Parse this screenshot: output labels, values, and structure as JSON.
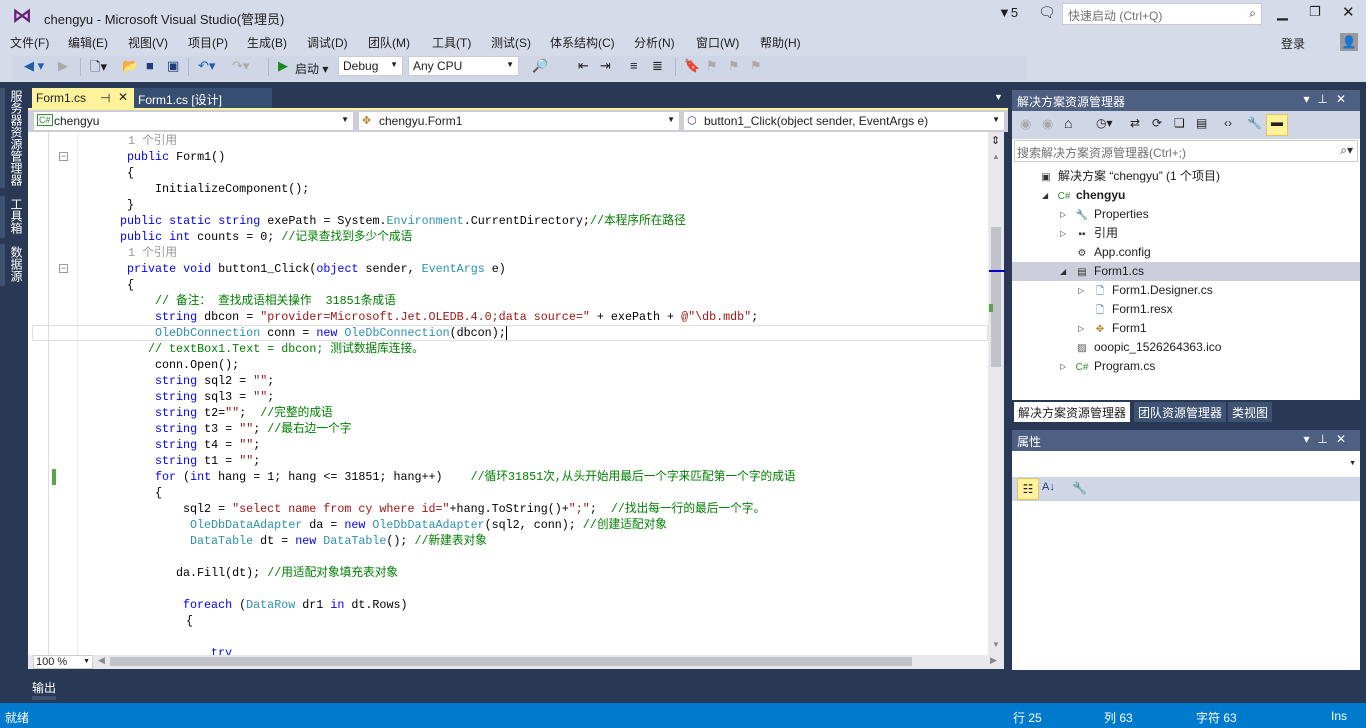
{
  "window": {
    "title": "chengyu - Microsoft Visual Studio(管理员)",
    "notifications": "5",
    "quick_launch_placeholder": "快速启动 (Ctrl+Q)",
    "sign_in": "登录"
  },
  "menu": [
    "文件(F)",
    "编辑(E)",
    "视图(V)",
    "项目(P)",
    "生成(B)",
    "调试(D)",
    "团队(M)",
    "工具(T)",
    "测试(S)",
    "体系结构(C)",
    "分析(N)",
    "窗口(W)",
    "帮助(H)"
  ],
  "toolbar": {
    "start": "启动",
    "configuration": "Debug",
    "platform": "Any CPU"
  },
  "left_tabs": [
    "服务器资源管理器",
    "工具箱",
    "数据源"
  ],
  "doc_tabs": [
    {
      "label": "Form1.cs",
      "active": true
    },
    {
      "label": "Form1.cs [设计]",
      "active": false
    }
  ],
  "navbar": {
    "project": "chengyu",
    "class": "chengyu.Form1",
    "member": "button1_Click(object sender, EventArgs e)"
  },
  "code": [
    {
      "indent": 100,
      "tokens": [
        [
          "1 个引用",
          "ln"
        ]
      ]
    },
    {
      "indent": 99,
      "fold": true,
      "tokens": [
        [
          "public",
          "kw"
        ],
        [
          " Form1()",
          "pl"
        ]
      ]
    },
    {
      "indent": 99,
      "tokens": [
        [
          "{",
          "pl"
        ]
      ]
    },
    {
      "indent": 127,
      "tokens": [
        [
          "InitializeComponent();",
          "pl"
        ]
      ]
    },
    {
      "indent": 99,
      "tokens": [
        [
          "}",
          "pl"
        ]
      ]
    },
    {
      "indent": 92,
      "tokens": [
        [
          "public static string",
          "kw"
        ],
        [
          " exePath = System.",
          "pl"
        ],
        [
          "Environment",
          "ty"
        ],
        [
          ".CurrentDirectory;",
          "pl"
        ],
        [
          "//本程序所在路径",
          "cm"
        ]
      ]
    },
    {
      "indent": 92,
      "tokens": [
        [
          "public int",
          "kw"
        ],
        [
          " counts = 0; ",
          "pl"
        ],
        [
          "//记录查找到多少个成语",
          "cm"
        ]
      ]
    },
    {
      "indent": 100,
      "tokens": [
        [
          "1 个引用",
          "ln"
        ]
      ]
    },
    {
      "indent": 99,
      "fold": true,
      "tokens": [
        [
          "private void",
          "kw"
        ],
        [
          " button1_Click(",
          "pl"
        ],
        [
          "object",
          "kw"
        ],
        [
          " sender, ",
          "pl"
        ],
        [
          "EventArgs",
          "ty"
        ],
        [
          " e)",
          "pl"
        ]
      ]
    },
    {
      "indent": 99,
      "tokens": [
        [
          "{",
          "pl"
        ]
      ]
    },
    {
      "indent": 127,
      "tokens": [
        [
          "// 备注： 查找成语相关操作  31851条成语",
          "cm"
        ]
      ]
    },
    {
      "indent": 127,
      "tokens": [
        [
          "string",
          "kw"
        ],
        [
          " dbcon = ",
          "pl"
        ],
        [
          "\"provider=Microsoft.Jet.OLEDB.4.0;data source=\"",
          "st"
        ],
        [
          " + exePath + ",
          "pl"
        ],
        [
          "@\"\\db.mdb\"",
          "st"
        ],
        [
          ";",
          "pl"
        ]
      ]
    },
    {
      "indent": 127,
      "current": true,
      "tokens": [
        [
          "OleDbConnection",
          "ty"
        ],
        [
          " conn = ",
          "pl"
        ],
        [
          "new",
          "kw"
        ],
        [
          " ",
          "pl"
        ],
        [
          "OleDbConnection",
          "ty"
        ],
        [
          "(dbcon);",
          "pl"
        ]
      ]
    },
    {
      "indent": 120,
      "tokens": [
        [
          "// textBox1.Text = dbcon; 测试数据库连接。",
          "cm"
        ]
      ]
    },
    {
      "indent": 127,
      "tokens": [
        [
          "conn.Open();",
          "pl"
        ]
      ]
    },
    {
      "indent": 127,
      "tokens": [
        [
          "string",
          "kw"
        ],
        [
          " sql2 = ",
          "pl"
        ],
        [
          "\"\"",
          "st"
        ],
        [
          ";",
          "pl"
        ]
      ]
    },
    {
      "indent": 127,
      "tokens": [
        [
          "string",
          "kw"
        ],
        [
          " sql3 = ",
          "pl"
        ],
        [
          "\"\"",
          "st"
        ],
        [
          ";",
          "pl"
        ]
      ]
    },
    {
      "indent": 127,
      "tokens": [
        [
          "string",
          "kw"
        ],
        [
          " t2=",
          "pl"
        ],
        [
          "\"\"",
          "st"
        ],
        [
          ";  ",
          "pl"
        ],
        [
          "//完整的成语",
          "cm"
        ]
      ]
    },
    {
      "indent": 127,
      "tokens": [
        [
          "string",
          "kw"
        ],
        [
          " t3 = ",
          "pl"
        ],
        [
          "\"\"",
          "st"
        ],
        [
          "; ",
          "pl"
        ],
        [
          "//最右边一个字",
          "cm"
        ]
      ]
    },
    {
      "indent": 127,
      "tokens": [
        [
          "string",
          "kw"
        ],
        [
          " t4 = ",
          "pl"
        ],
        [
          "\"\"",
          "st"
        ],
        [
          ";",
          "pl"
        ]
      ]
    },
    {
      "indent": 127,
      "tokens": [
        [
          "string",
          "kw"
        ],
        [
          " t1 = ",
          "pl"
        ],
        [
          "\"\"",
          "st"
        ],
        [
          ";",
          "pl"
        ]
      ]
    },
    {
      "indent": 127,
      "changed": true,
      "tokens": [
        [
          "for",
          "kw"
        ],
        [
          " (",
          "pl"
        ],
        [
          "int",
          "kw"
        ],
        [
          " hang = 1; hang <= 31851; hang++)    ",
          "pl"
        ],
        [
          "//循环31851次,从头开始用最后一个字来匹配第一个字的成语",
          "cm"
        ]
      ]
    },
    {
      "indent": 127,
      "tokens": [
        [
          "{",
          "pl"
        ]
      ]
    },
    {
      "indent": 155,
      "tokens": [
        [
          "sql2 = ",
          "pl"
        ],
        [
          "\"select name from cy where id=\"",
          "st"
        ],
        [
          "+hang.ToString()+",
          "pl"
        ],
        [
          "\";\"",
          "st"
        ],
        [
          ";  ",
          "pl"
        ],
        [
          "//找出每一行的最后一个字。",
          "cm"
        ]
      ]
    },
    {
      "indent": 162,
      "tokens": [
        [
          "OleDbDataAdapter",
          "ty"
        ],
        [
          " da = ",
          "pl"
        ],
        [
          "new",
          "kw"
        ],
        [
          " ",
          "pl"
        ],
        [
          "OleDbDataAdapter",
          "ty"
        ],
        [
          "(sql2, conn); ",
          "pl"
        ],
        [
          "//创建适配对象",
          "cm"
        ]
      ]
    },
    {
      "indent": 162,
      "tokens": [
        [
          "DataTable",
          "ty"
        ],
        [
          " dt = ",
          "pl"
        ],
        [
          "new",
          "kw"
        ],
        [
          " ",
          "pl"
        ],
        [
          "DataTable",
          "ty"
        ],
        [
          "(); ",
          "pl"
        ],
        [
          "//新建表对象",
          "cm"
        ]
      ]
    },
    {
      "indent": 0,
      "tokens": []
    },
    {
      "indent": 148,
      "tokens": [
        [
          "da.Fill(dt); ",
          "pl"
        ],
        [
          "//用适配对象填充表对象",
          "cm"
        ]
      ]
    },
    {
      "indent": 0,
      "tokens": []
    },
    {
      "indent": 155,
      "tokens": [
        [
          "foreach",
          "kw"
        ],
        [
          " (",
          "pl"
        ],
        [
          "DataRow",
          "ty"
        ],
        [
          " dr1 ",
          "pl"
        ],
        [
          "in",
          "kw"
        ],
        [
          " dt.Rows)",
          "pl"
        ]
      ]
    },
    {
      "indent": 158,
      "tokens": [
        [
          "{",
          "pl"
        ]
      ]
    },
    {
      "indent": 0,
      "tokens": []
    },
    {
      "indent": 183,
      "tokens": [
        [
          "try",
          "kw"
        ]
      ]
    }
  ],
  "zoom": "100 %",
  "solution_explorer": {
    "title": "解决方案资源管理器",
    "search_placeholder": "搜索解决方案资源管理器(Ctrl+;)",
    "items": [
      {
        "label": "解决方案 “chengyu” (1 个项目)",
        "level": 0,
        "icon": "solution-icon",
        "expander": ""
      },
      {
        "label": "chengyu",
        "level": 1,
        "icon": "csharp-project-icon",
        "expander": "expanded",
        "bold": true
      },
      {
        "label": "Properties",
        "level": 2,
        "icon": "wrench-icon",
        "expander": "collapsed"
      },
      {
        "label": "引用",
        "level": 2,
        "icon": "references-icon",
        "expander": "collapsed"
      },
      {
        "label": "App.config",
        "level": 2,
        "icon": "config-icon",
        "expander": ""
      },
      {
        "label": "Form1.cs",
        "level": 2,
        "icon": "form-icon",
        "expander": "expanded",
        "selected": true
      },
      {
        "label": "Form1.Designer.cs",
        "level": 3,
        "icon": "file-icon",
        "expander": "collapsed"
      },
      {
        "label": "Form1.resx",
        "level": 3,
        "icon": "file-icon",
        "expander": ""
      },
      {
        "label": "Form1",
        "level": 3,
        "icon": "class-icon",
        "expander": "collapsed"
      },
      {
        "label": "ooopic_1526264363.ico",
        "level": 2,
        "icon": "image-icon",
        "expander": ""
      },
      {
        "label": "Program.cs",
        "level": 2,
        "icon": "csharp-file-icon",
        "expander": "collapsed"
      }
    ],
    "tabs": [
      "解决方案资源管理器",
      "团队资源管理器",
      "类视图"
    ]
  },
  "properties": {
    "title": "属性"
  },
  "output_tab": "输出",
  "status": {
    "ready": "就绪",
    "line": "行 25",
    "col": "列 63",
    "char": "字符 63",
    "mode": "Ins"
  },
  "colors": {
    "accent": "#007acc",
    "frame": "#293955",
    "chrome": "#d6dbe9",
    "active_tab": "#fff29d"
  }
}
